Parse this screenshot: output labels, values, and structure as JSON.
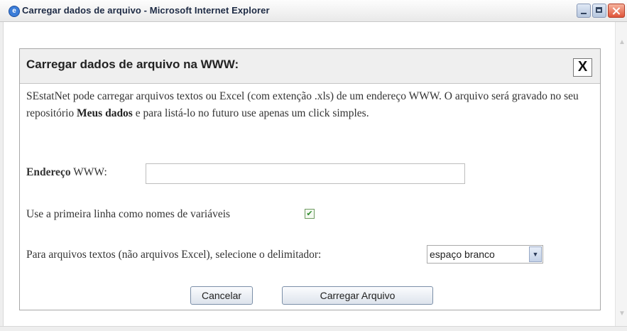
{
  "window": {
    "title": "Carregar dados de arquivo - Microsoft Internet Explorer",
    "icon": "ie-page-icon",
    "controls": [
      "minimize-icon",
      "maximize-icon",
      "close-icon"
    ]
  },
  "dialog": {
    "title": "Carregar dados de arquivo na WWW:",
    "close_label": "X",
    "description": {
      "part1": "SEstatNet pode carregar arquivos textos ou Excel (com extenção .xls) de um endereço WWW. O arquivo será gravado no seu repositório ",
      "bold": "Meus dados",
      "part2": " e para listá-lo no futuro use apenas um click simples."
    },
    "address": {
      "label_bold": "Endereço",
      "label_rest": " WWW:",
      "value": "",
      "placeholder": ""
    },
    "first_line": {
      "label": "Use a primeira linha como nomes de variáveis",
      "checked": true,
      "check_glyph": "✔"
    },
    "delimiter": {
      "label": "Para arquivos textos (não arquivos Excel), selecione o delimitador:",
      "selected": "espaço branco"
    },
    "buttons": {
      "cancel": "Cancelar",
      "load": "Carregar Arquivo"
    }
  }
}
